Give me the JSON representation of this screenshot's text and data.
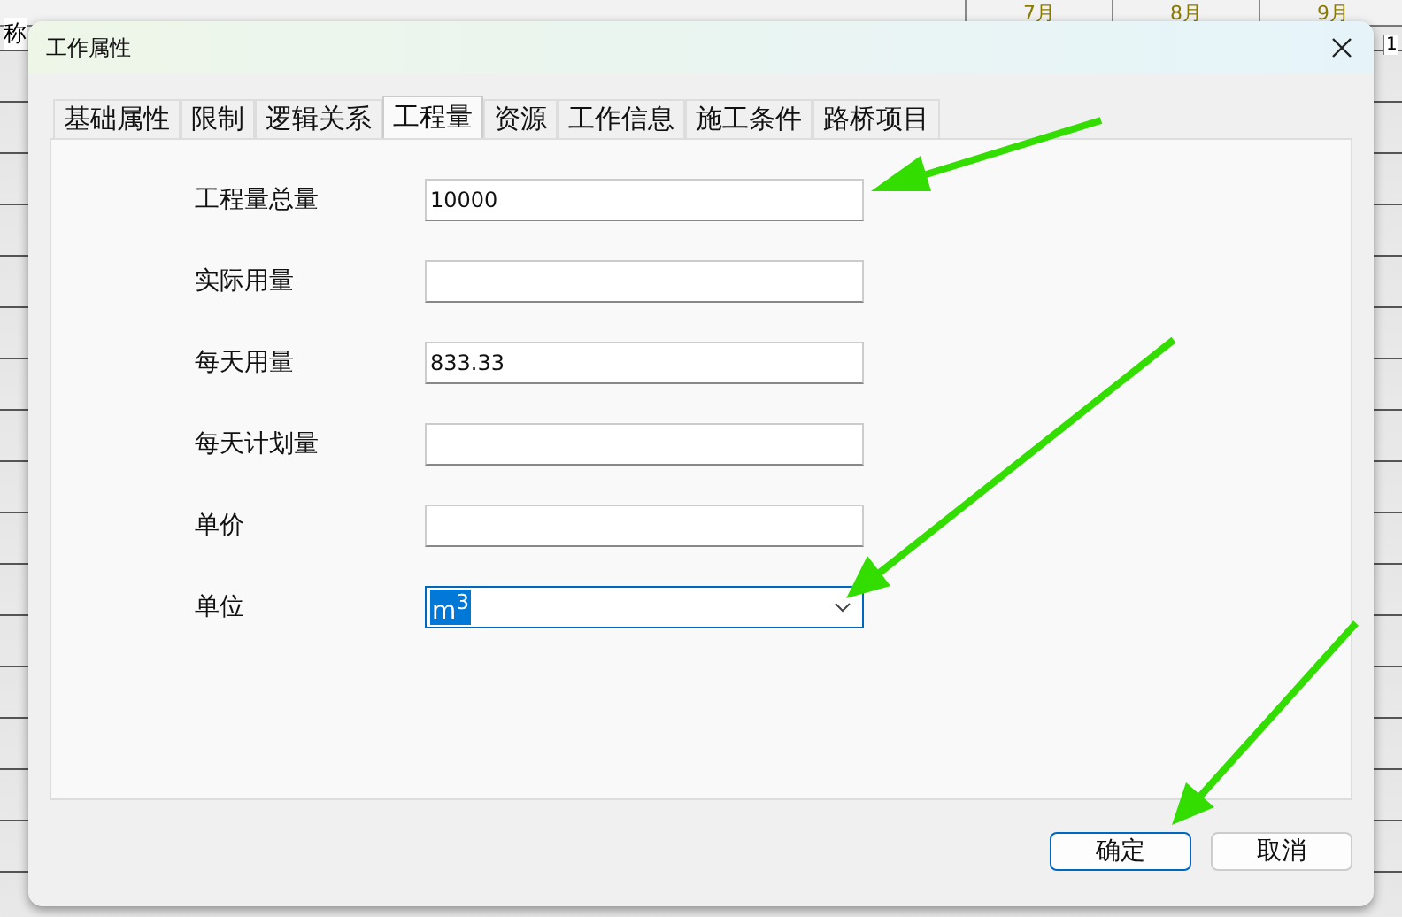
{
  "background_sheet": {
    "name_header": "称",
    "months": [
      "7月",
      "8月",
      "9月"
    ],
    "day": "1"
  },
  "window": {
    "title": "工作属性"
  },
  "tabs": [
    {
      "label": "基础属性",
      "selected": false
    },
    {
      "label": "限制",
      "selected": false
    },
    {
      "label": "逻辑关系",
      "selected": false
    },
    {
      "label": "工程量",
      "selected": true
    },
    {
      "label": "资源",
      "selected": false
    },
    {
      "label": "工作信息",
      "selected": false
    },
    {
      "label": "施工条件",
      "selected": false
    },
    {
      "label": "路桥项目",
      "selected": false
    }
  ],
  "fields": [
    {
      "label": "工程量总量",
      "kind": "text",
      "value": "10000"
    },
    {
      "label": "实际用量",
      "kind": "text"
    },
    {
      "label": "每天用量",
      "kind": "text",
      "value": "833.33"
    },
    {
      "label": "每天计划量",
      "kind": "text"
    },
    {
      "label": "单价",
      "kind": "text"
    },
    {
      "label": "单位",
      "kind": "dropdown",
      "value": "m$^{3}$",
      "focused": true
    }
  ],
  "buttons": [
    {
      "label": "确定",
      "default": true
    },
    {
      "label": "取消",
      "default": false
    }
  ]
}
